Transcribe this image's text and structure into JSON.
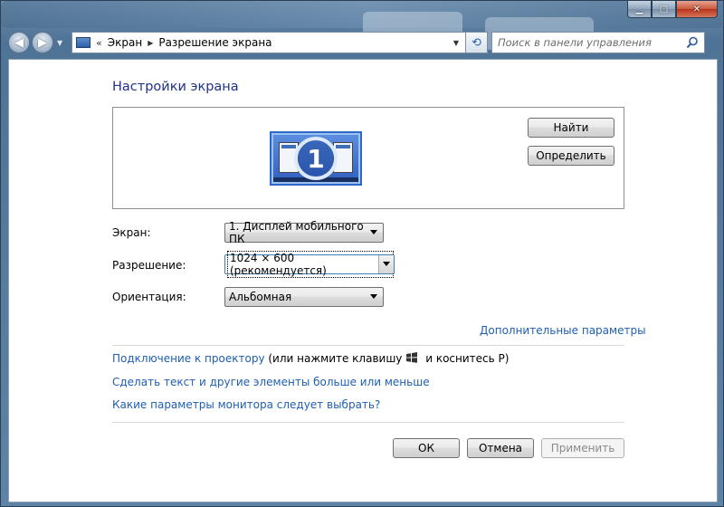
{
  "window": {
    "caption_buttons": [
      "minimize",
      "maximize",
      "close"
    ]
  },
  "nav": {
    "breadcrumb_chevron": "«",
    "crumbs": [
      "Экран",
      "Разрешение экрана"
    ],
    "search_placeholder": "Поиск в панели управления"
  },
  "main": {
    "title": "Настройки экрана",
    "find_button": "Найти",
    "detect_button": "Определить",
    "monitor_number": "1",
    "screen_label": "Экран:",
    "screen_value": "1. Дисплей мобильного ПК",
    "resolution_label": "Разрешение:",
    "resolution_value": "1024 × 600 (рекомендуется)",
    "orientation_label": "Ориентация:",
    "orientation_value": "Альбомная",
    "advanced_link": "Дополнительные параметры",
    "projector_link": "Подключение к проектору",
    "projector_hint_pre": " (или нажмите клавишу",
    "projector_hint_post": " и коснитесь P)",
    "text_size_link": "Сделать текст и другие элементы больше или меньше",
    "monitor_help_link": "Какие параметры монитора следует выбрать?"
  },
  "footer": {
    "ok": "ОК",
    "cancel": "Отмена",
    "apply": "Применить"
  },
  "colors": {
    "title": "#1e3287",
    "link": "#1e5fb3",
    "frame": "#4f7396"
  }
}
